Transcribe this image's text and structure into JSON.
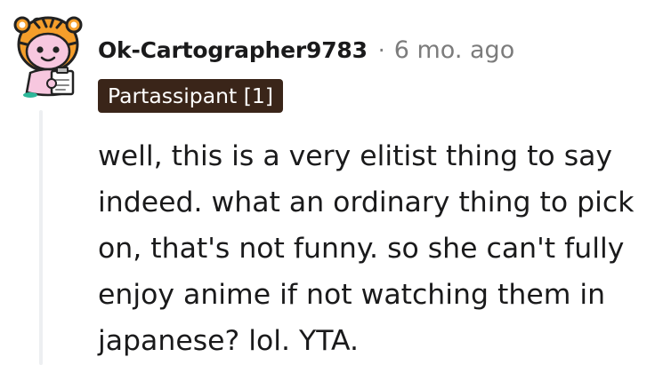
{
  "comment": {
    "username": "Ok-Cartographer9783",
    "separator": "·",
    "timestamp": "6 mo. ago",
    "flair": "Partassipant [1]",
    "body_lines": [
      "well, this is a very elitist thing to say",
      "indeed. what an ordinary thing to pick",
      "on, that's not funny. so she can't fully",
      "enjoy anime if not watching them in",
      "japanese? lol. YTA."
    ]
  },
  "icons": {
    "avatar": "snoo-tiger-costume-avatar-icon"
  },
  "colors": {
    "flair_background": "#3a2519",
    "flair_text": "#ffffff",
    "meta_gray": "#7c7c7c",
    "thread_line": "#edeff1"
  }
}
